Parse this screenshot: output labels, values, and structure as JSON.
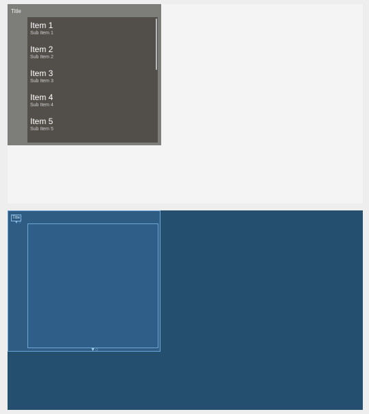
{
  "window": {
    "title": "Title",
    "items": [
      {
        "title": "Item 1",
        "sub": "Sub Item 1"
      },
      {
        "title": "Item 2",
        "sub": "Sub Item 2"
      },
      {
        "title": "Item 3",
        "sub": "Sub Item 3"
      },
      {
        "title": "Item 4",
        "sub": "Sub Item 4"
      },
      {
        "title": "Item 5",
        "sub": "Sub Item 5"
      }
    ]
  },
  "blueprint": {
    "title": "Title"
  },
  "colors": {
    "design_background": "#f4f4f4",
    "window_frame": "#7d7d7a",
    "list_background": "#524e4a",
    "blueprint_background": "#254f6e",
    "blueprint_outline": "#6ea6d6"
  }
}
